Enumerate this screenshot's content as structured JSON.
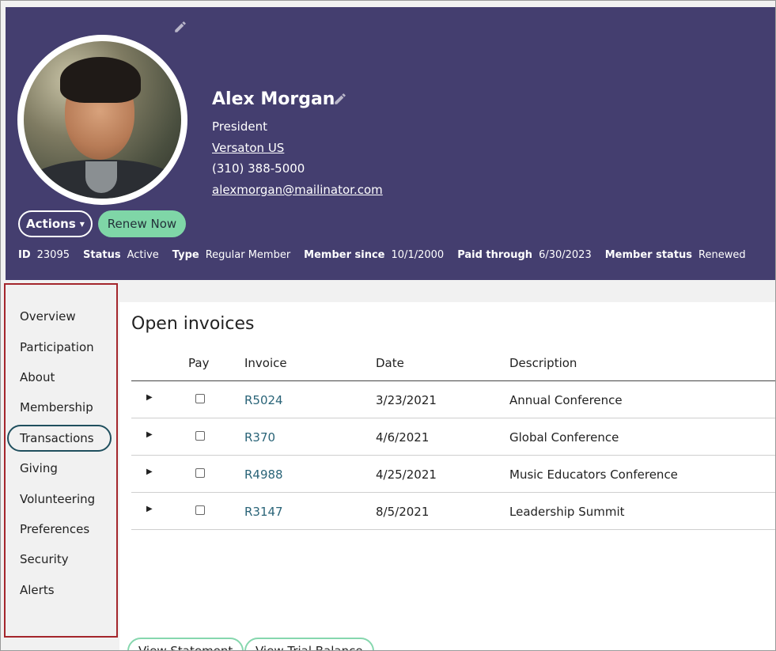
{
  "profile": {
    "name": "Alex Morgan",
    "title": "President",
    "company": "Versaton US",
    "phone": "(310) 388-5000",
    "email": "alexmorgan@mailinator.com"
  },
  "actions": {
    "actions_label": "Actions",
    "renew_label": "Renew Now"
  },
  "meta": [
    {
      "label": "ID",
      "value": "23095"
    },
    {
      "label": "Status",
      "value": "Active"
    },
    {
      "label": "Type",
      "value": "Regular Member"
    },
    {
      "label": "Member since",
      "value": "10/1/2000"
    },
    {
      "label": "Paid through",
      "value": "6/30/2023"
    },
    {
      "label": "Member status",
      "value": "Renewed"
    }
  ],
  "sidebar": {
    "items": [
      {
        "label": "Overview"
      },
      {
        "label": "Participation"
      },
      {
        "label": "About"
      },
      {
        "label": "Membership"
      },
      {
        "label": "Transactions",
        "active": true
      },
      {
        "label": "Giving"
      },
      {
        "label": "Volunteering"
      },
      {
        "label": "Preferences"
      },
      {
        "label": "Security"
      },
      {
        "label": "Alerts"
      }
    ]
  },
  "invoices": {
    "title": "Open invoices",
    "columns": [
      "Pay",
      "Invoice",
      "Date",
      "Description"
    ],
    "rows": [
      {
        "invoice": "R5024",
        "date": "3/23/2021",
        "description": "Annual Conference"
      },
      {
        "invoice": "R370",
        "date": "4/6/2021",
        "description": "Global Conference"
      },
      {
        "invoice": "R4988",
        "date": "4/25/2021",
        "description": "Music Educators Conference"
      },
      {
        "invoice": "R3147",
        "date": "8/5/2021",
        "description": "Leadership Summit"
      }
    ]
  },
  "footer_buttons": {
    "view_statement": "View Statement",
    "view_trial_balance": "View Trial Balance"
  },
  "colors": {
    "header_bg": "#443e6f",
    "renew_bg": "#7fd6a7",
    "highlight_border": "#a4262c",
    "link": "#2a6478"
  }
}
